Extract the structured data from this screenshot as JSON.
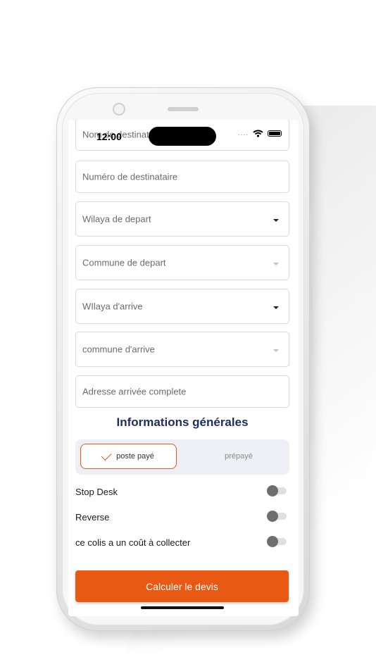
{
  "status_bar": {
    "time": "12:00",
    "dots": "...."
  },
  "form": {
    "fields": [
      {
        "label": "Nom de destinataire"
      },
      {
        "label": "Numéro de destinataire"
      },
      {
        "label": "Wilaya de depart"
      },
      {
        "label": "Commune de depart"
      },
      {
        "label": "WIlaya d'arrive"
      },
      {
        "label": "commune d'arrive"
      },
      {
        "label": "Adresse arrivée complete"
      }
    ]
  },
  "section": {
    "title": "Informations générales"
  },
  "payment_toggle": {
    "options": [
      "poste payé",
      "prépayé"
    ],
    "selected": "poste payé"
  },
  "toggles": [
    {
      "label": "Stop Desk",
      "on": false
    },
    {
      "label": "Reverse",
      "on": false
    },
    {
      "label": "ce colis a un coût à collecter",
      "on": false
    }
  ],
  "cta": {
    "label": "Calculer le devis"
  },
  "colors": {
    "accent": "#e85a14",
    "title": "#1f2d5a"
  }
}
